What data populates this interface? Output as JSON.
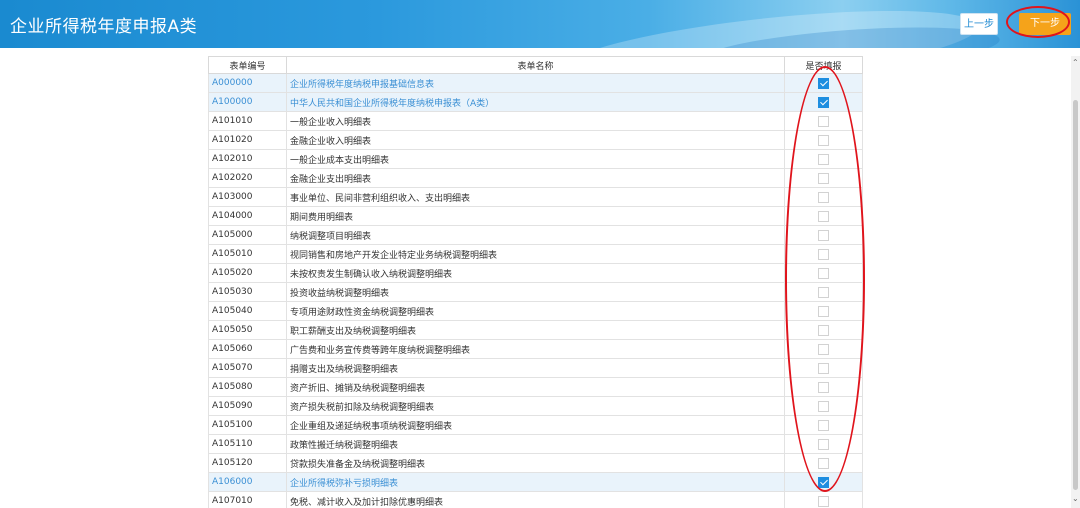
{
  "header": {
    "title": "企业所得税年度申报A类",
    "prev_label": "上一步",
    "next_label": "下一步"
  },
  "table": {
    "columns": [
      "表单编号",
      "表单名称",
      "是否填报"
    ],
    "rows": [
      {
        "code": "A000000",
        "name": "企业所得税年度纳税申报基础信息表",
        "checked": true
      },
      {
        "code": "A100000",
        "name": "中华人民共和国企业所得税年度纳税申报表（A类）",
        "checked": true
      },
      {
        "code": "A101010",
        "name": "一般企业收入明细表",
        "checked": false
      },
      {
        "code": "A101020",
        "name": "金融企业收入明细表",
        "checked": false
      },
      {
        "code": "A102010",
        "name": "一般企业成本支出明细表",
        "checked": false
      },
      {
        "code": "A102020",
        "name": "金融企业支出明细表",
        "checked": false
      },
      {
        "code": "A103000",
        "name": "事业单位、民间非营利组织收入、支出明细表",
        "checked": false
      },
      {
        "code": "A104000",
        "name": "期间费用明细表",
        "checked": false
      },
      {
        "code": "A105000",
        "name": "纳税调整项目明细表",
        "checked": false
      },
      {
        "code": "A105010",
        "name": "视同销售和房地产开发企业特定业务纳税调整明细表",
        "checked": false
      },
      {
        "code": "A105020",
        "name": "未按权责发生制确认收入纳税调整明细表",
        "checked": false
      },
      {
        "code": "A105030",
        "name": "投资收益纳税调整明细表",
        "checked": false
      },
      {
        "code": "A105040",
        "name": "专项用途财政性资金纳税调整明细表",
        "checked": false
      },
      {
        "code": "A105050",
        "name": "职工薪酬支出及纳税调整明细表",
        "checked": false
      },
      {
        "code": "A105060",
        "name": "广告费和业务宣传费等跨年度纳税调整明细表",
        "checked": false
      },
      {
        "code": "A105070",
        "name": "捐赠支出及纳税调整明细表",
        "checked": false
      },
      {
        "code": "A105080",
        "name": "资产折旧、摊销及纳税调整明细表",
        "checked": false
      },
      {
        "code": "A105090",
        "name": "资产损失税前扣除及纳税调整明细表",
        "checked": false
      },
      {
        "code": "A105100",
        "name": "企业重组及递延纳税事项纳税调整明细表",
        "checked": false
      },
      {
        "code": "A105110",
        "name": "政策性搬迁纳税调整明细表",
        "checked": false
      },
      {
        "code": "A105120",
        "name": "贷款损失准备金及纳税调整明细表",
        "checked": false
      },
      {
        "code": "A106000",
        "name": "企业所得税弥补亏损明细表",
        "checked": true
      },
      {
        "code": "A107010",
        "name": "免税、减计收入及加计扣除优惠明细表",
        "checked": false
      }
    ]
  },
  "colors": {
    "header_blue": "#1a8ad0",
    "next_button": "#f5a31a",
    "checked_blue": "#1e8ee0",
    "annotation_red": "#e0141c"
  }
}
